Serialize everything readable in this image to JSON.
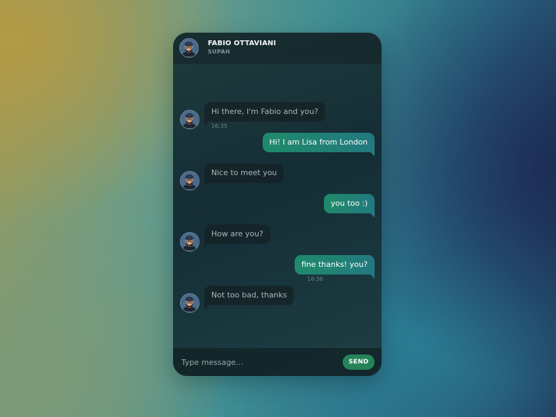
{
  "header": {
    "name": "FABIO OTTAVIANI",
    "subtitle": "SUPAH",
    "avatar_icon": "user-avatar-icon"
  },
  "messages": [
    {
      "from": "contact",
      "text": "Hi there, I'm Fabio and you?",
      "time": "16:35"
    },
    {
      "from": "me",
      "text": "Hi! I am Lisa from London",
      "time": ""
    },
    {
      "from": "contact",
      "text": "Nice to meet you",
      "time": ""
    },
    {
      "from": "me",
      "text": "you too :)",
      "time": ""
    },
    {
      "from": "contact",
      "text": "How are you?",
      "time": ""
    },
    {
      "from": "me",
      "text": "fine thanks! you?",
      "time": "16:36"
    },
    {
      "from": "contact",
      "text": "Not too bad, thanks",
      "time": ""
    }
  ],
  "composer": {
    "placeholder": "Type message...",
    "value": "",
    "send_label": "SEND"
  },
  "colors": {
    "outgoing_bubble": "#1f8a6a",
    "incoming_bubble": "#142024",
    "send_button": "#248457",
    "panel": "#152d36"
  }
}
